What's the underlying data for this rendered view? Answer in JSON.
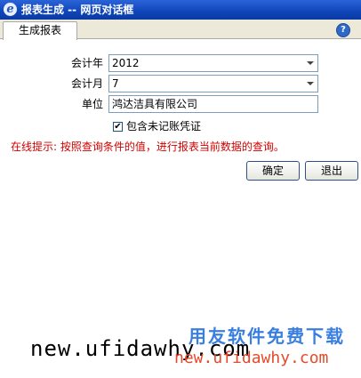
{
  "window": {
    "icon": "ie-icon",
    "title": "报表生成 -- 网页对话框"
  },
  "tabs": [
    {
      "label": "生成报表"
    }
  ],
  "help": {
    "icon": "help-icon",
    "glyph": "?"
  },
  "form": {
    "year_label": "会计年",
    "year_value": "2012",
    "month_label": "会计月",
    "month_value": "7",
    "unit_label": "单位",
    "unit_value": "鸿达洁具有限公司",
    "include_unposted_label": "包含未记账凭证",
    "include_unposted_checked": true,
    "check_mark": "✔"
  },
  "hint": "在线提示: 按照查询条件的值，进行报表当前数据的查询。",
  "buttons": {
    "ok": "确定",
    "exit": "退出"
  },
  "watermark": {
    "cn": "用友软件免费下载",
    "url_black": "new.ufidawhy.com",
    "url_orange": "new.ufidawhy.com"
  }
}
